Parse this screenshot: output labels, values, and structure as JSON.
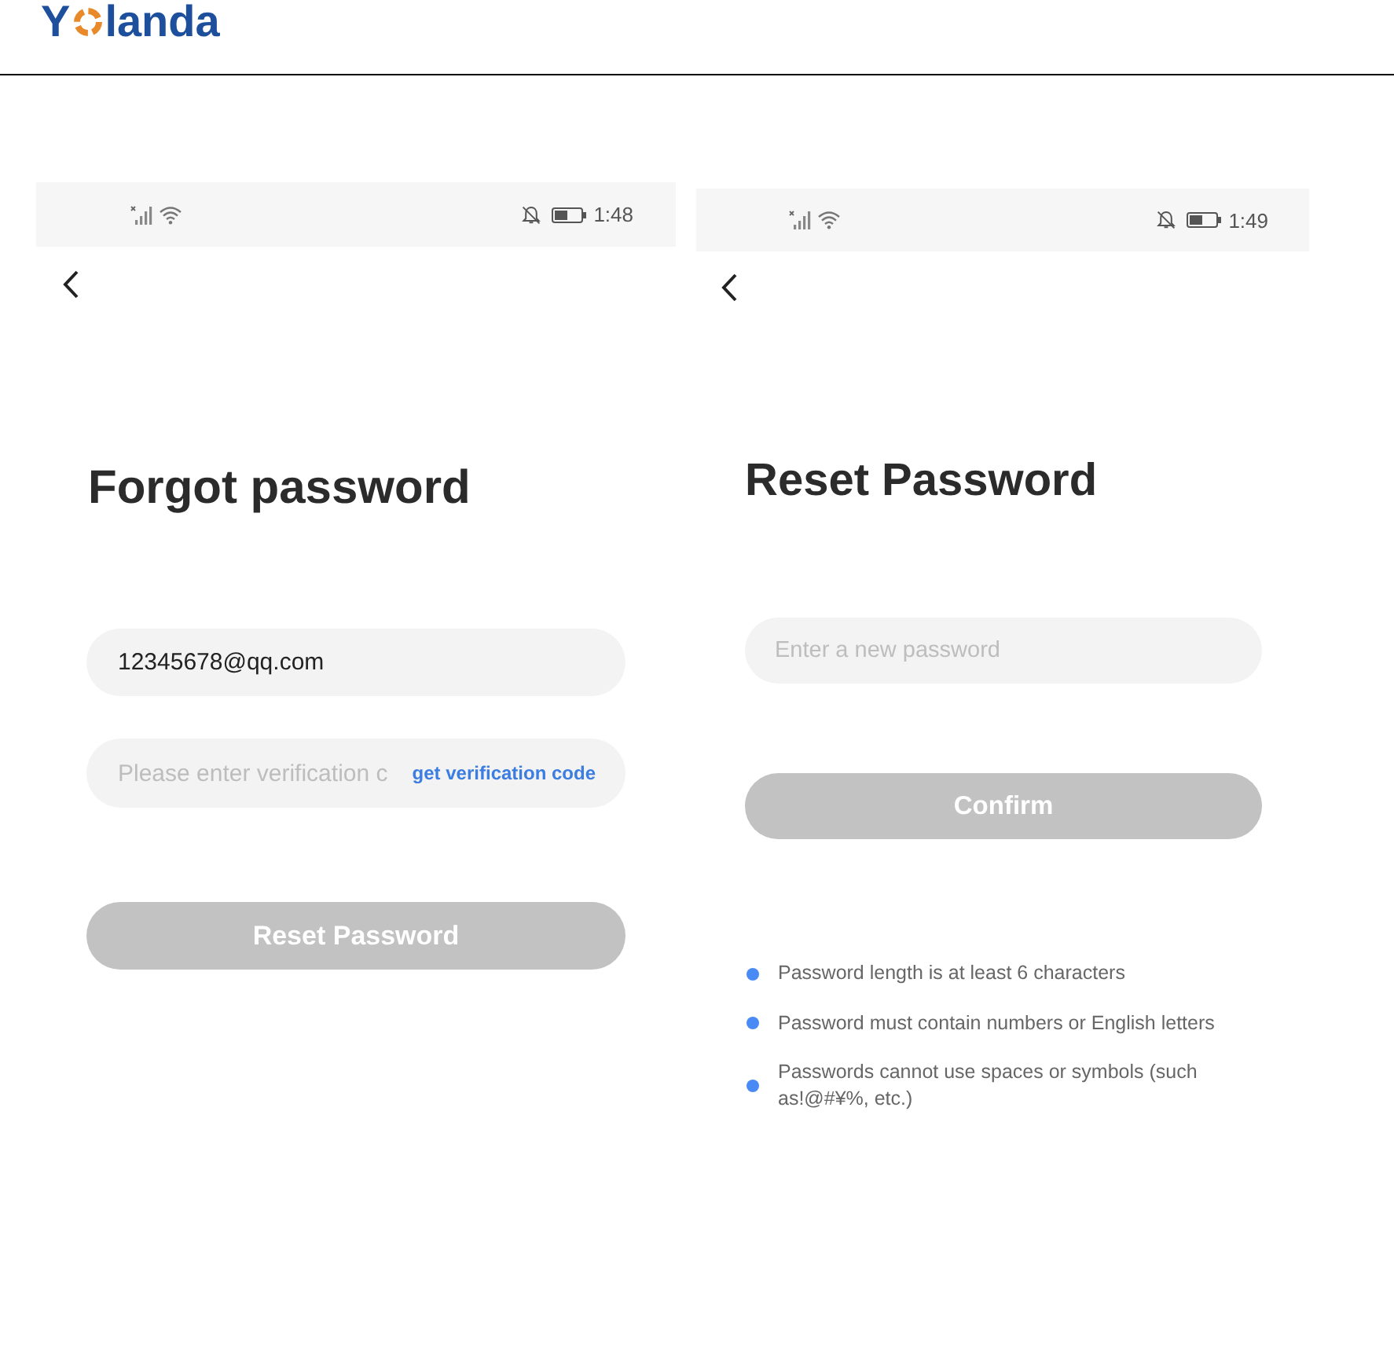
{
  "header": {
    "logo": {
      "text_before": "Y",
      "text_after": "landa"
    }
  },
  "screens": [
    {
      "status_bar": {
        "time": "1:48"
      },
      "title": "Forgot password",
      "fields": [
        {
          "kind": "email",
          "value": "12345678@qq.com"
        },
        {
          "kind": "code",
          "placeholder": "Please enter verification c",
          "link": "get verification code"
        }
      ],
      "button": {
        "label": "Reset Password",
        "disabled": true
      }
    },
    {
      "status_bar": {
        "time": "1:49"
      },
      "title": "Reset Password",
      "fields": [
        {
          "kind": "password",
          "placeholder": "Enter a new password"
        }
      ],
      "button": {
        "label": "Confirm",
        "disabled": true
      },
      "rules": [
        "Password length is at least 6 characters",
        "Password must contain numbers or English letters",
        "Passwords cannot use spaces or symbols (such as!@#¥%, etc.)"
      ]
    }
  ]
}
